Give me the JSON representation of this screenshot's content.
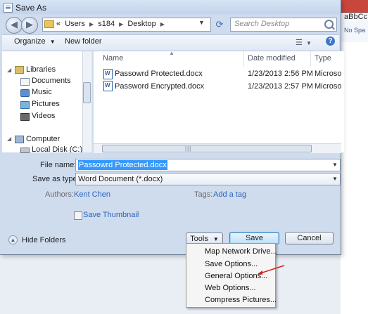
{
  "window": {
    "title": "Save As"
  },
  "background_app": {
    "text1": "aBbCc",
    "text2": "No Spa"
  },
  "nav": {
    "address_prefix": "«",
    "breadcrumbs": [
      "Users",
      "s184",
      "Desktop"
    ],
    "search_placeholder": "Search Desktop"
  },
  "toolbar": {
    "organize": "Organize",
    "new_folder": "New folder",
    "help": "?"
  },
  "sidebar": {
    "items": [
      {
        "label": "Libraries",
        "icon": "library-icon"
      },
      {
        "label": "Documents",
        "icon": "documents-icon"
      },
      {
        "label": "Music",
        "icon": "music-icon"
      },
      {
        "label": "Pictures",
        "icon": "pictures-icon"
      },
      {
        "label": "Videos",
        "icon": "videos-icon"
      },
      {
        "label": "Computer",
        "icon": "computer-icon"
      },
      {
        "label": "Local Disk (C:)",
        "icon": "disk-icon"
      }
    ]
  },
  "file_list": {
    "columns": [
      "Name",
      "Date modified",
      "Type"
    ],
    "rows": [
      {
        "name": "Passowrd Protected.docx",
        "date": "1/23/2013 2:56 PM",
        "type": "Microsoft"
      },
      {
        "name": "Password Encrypted.docx",
        "date": "1/23/2013 2:57 PM",
        "type": "Microsoft"
      }
    ]
  },
  "form": {
    "file_name_label": "File name:",
    "file_name_value": "Passowrd Protected.docx",
    "save_as_type_label": "Save as type:",
    "save_as_type_value": "Word Document (*.docx)",
    "authors_label": "Authors:",
    "authors_value": "Kent Chen",
    "tags_label": "Tags:",
    "tags_value": "Add a tag",
    "save_thumbnail": "Save Thumbnail"
  },
  "footer": {
    "hide_folders": "Hide Folders",
    "tools": "Tools",
    "save": "Save",
    "cancel": "Cancel"
  },
  "tools_menu": {
    "items": [
      "Map Network Drive...",
      "Save Options...",
      "General Options...",
      "Web Options...",
      "Compress Pictures..."
    ],
    "highlighted_item": "General Options..."
  },
  "colors": {
    "selection": "#3399ff",
    "link": "#2b63b8",
    "annotation_arrow": "#d81e1e"
  }
}
